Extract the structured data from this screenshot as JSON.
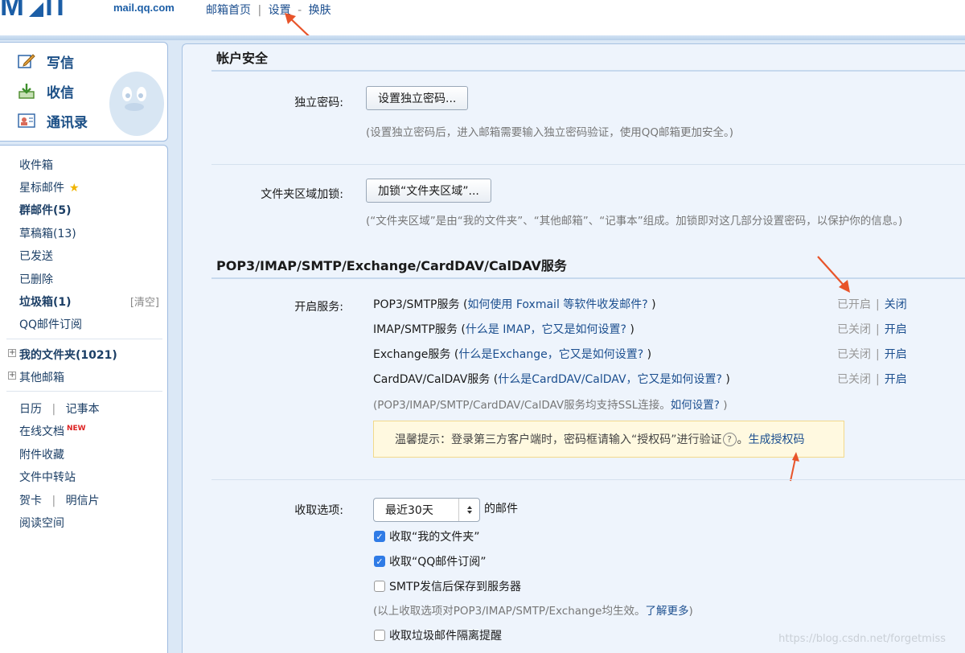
{
  "header": {
    "logo_url_text": "mail.qq.com",
    "nav": {
      "home": "邮箱首页",
      "sep": "|",
      "settings": "设置",
      "dash": "-",
      "skin": "换肤"
    }
  },
  "sidebar": {
    "compose": [
      {
        "label": "写信",
        "icon": "compose-pen-icon"
      },
      {
        "label": "收信",
        "icon": "inbox-download-icon"
      },
      {
        "label": "通讯录",
        "icon": "contacts-card-icon"
      }
    ],
    "folders": [
      {
        "label": "收件箱",
        "bold": false
      },
      {
        "label": "星标邮件",
        "bold": false,
        "star": "★"
      },
      {
        "label": "群邮件(5)",
        "bold": true
      },
      {
        "label": "草稿箱(13)",
        "bold": false
      },
      {
        "label": "已发送",
        "bold": false
      },
      {
        "label": "已删除",
        "bold": false
      },
      {
        "label": "垃圾箱(1)",
        "bold": true,
        "right": "[清空]"
      },
      {
        "label": "QQ邮件订阅",
        "bold": false
      }
    ],
    "tree": [
      {
        "label": "我的文件夹(1021)",
        "bold": true
      },
      {
        "label": "其他邮箱",
        "bold": false
      }
    ],
    "tools": {
      "calendar": "日历",
      "notes": "记事本",
      "sep": "|",
      "docs": "在线文档",
      "new_badge": "NEW",
      "attachments": "附件收藏",
      "transfer": "文件中转站",
      "card": "贺卡",
      "postcard": "明信片",
      "reading": "阅读空间"
    }
  },
  "main": {
    "security": {
      "title": "帐户安全",
      "pwd_label": "独立密码:",
      "pwd_button": "设置独立密码...",
      "pwd_hint": "(设置独立密码后，进入邮箱需要输入独立密码验证，使用QQ邮箱更加安全。)",
      "lock_label": "文件夹区域加锁:",
      "lock_button": "加锁“文件夹区域”...",
      "lock_hint": "(“文件夹区域”是由“我的文件夹”、“其他邮箱”、“记事本”组成。加锁即对这几部分设置密码，以保护你的信息。)"
    },
    "services": {
      "title": "POP3/IMAP/SMTP/Exchange/CardDAV/CalDAV服务",
      "label": "开启服务:",
      "rows": [
        {
          "name": "POP3/SMTP服务",
          "open_paren": " (",
          "link": "如何使用 Foxmail 等软件收发邮件?",
          "close_paren": " )",
          "state": "已开启",
          "action": "关闭"
        },
        {
          "name": "IMAP/SMTP服务",
          "open_paren": " (",
          "link": "什么是 IMAP，它又是如何设置?",
          "close_paren": " )",
          "state": "已关闭",
          "action": "开启"
        },
        {
          "name": "Exchange服务",
          "open_paren": " (",
          "link": "什么是Exchange，它又是如何设置?",
          "close_paren": " )",
          "state": "已关闭",
          "action": "开启"
        },
        {
          "name": "CardDAV/CalDAV服务",
          "open_paren": " (",
          "link": "什么是CardDAV/CalDAV，它又是如何设置?",
          "close_paren": " )",
          "state": "已关闭",
          "action": "开启"
        }
      ],
      "separator": "|",
      "ssl_hint": "(POP3/IMAP/SMTP/CardDAV/CalDAV服务均支持SSL连接。",
      "ssl_link": "如何设置?",
      "ssl_hint_end": " )",
      "tip_text": "温馨提示：登录第三方客户端时，密码框请输入“授权码”进行验证",
      "tip_q": "?",
      "tip_period": "。",
      "tip_link": "生成授权码"
    },
    "receive": {
      "label": "收取选项:",
      "select_value": "最近30天",
      "select_caret": "◆",
      "suffix": "的邮件",
      "options": [
        {
          "label": "收取“我的文件夹”",
          "checked": true
        },
        {
          "label": "收取“QQ邮件订阅”",
          "checked": true
        },
        {
          "label": "SMTP发信后保存到服务器",
          "checked": false
        }
      ],
      "hint": "(以上收取选项对POP3/IMAP/SMTP/Exchange均生效。",
      "hint_link": "了解更多",
      "hint_end": ")",
      "spam_option": {
        "label": "收取垃圾邮件隔离提醒",
        "checked": false
      }
    }
  },
  "watermark": "https://blog.csdn.net/forgetmiss",
  "colors": {
    "link": "#1c4f8f",
    "accent_blue": "#1c5ea6",
    "tip_bg": "#fff9e0",
    "annotation_arrow": "#e8542a"
  }
}
